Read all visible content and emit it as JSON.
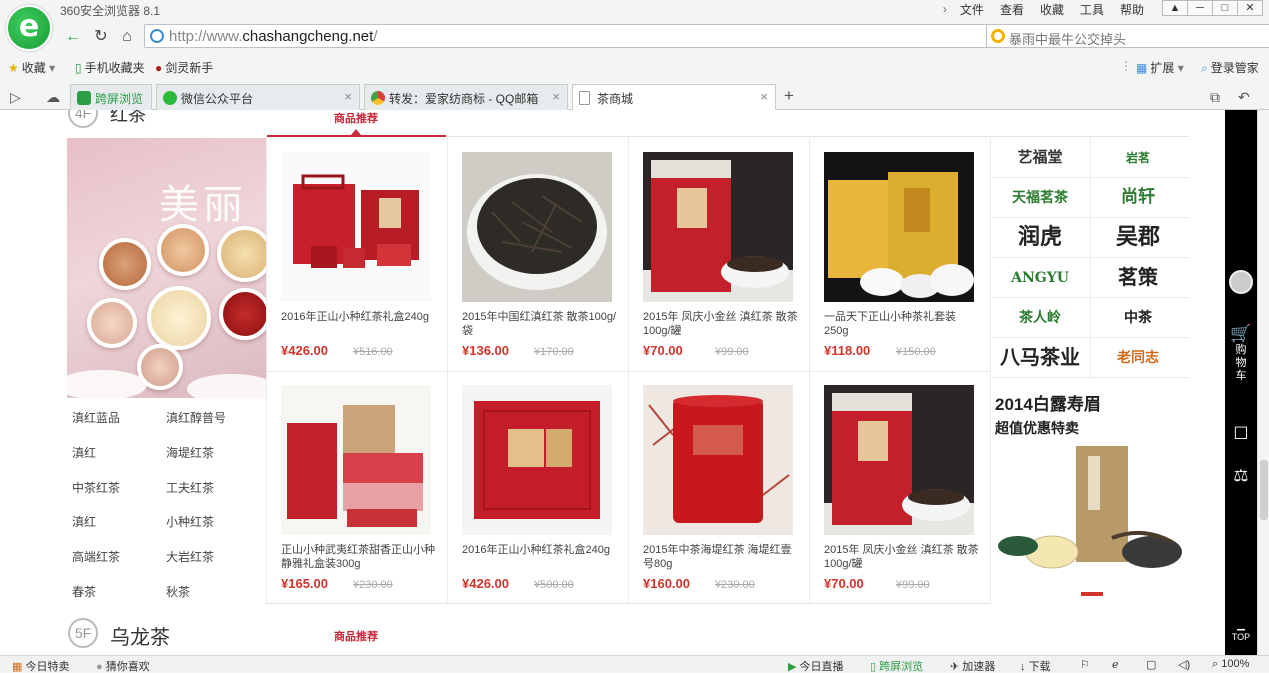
{
  "browser": {
    "app_title": "360安全浏览器 8.1",
    "menus": [
      "文件",
      "查看",
      "收藏",
      "工具",
      "帮助"
    ],
    "url_prefix": "http://www.",
    "url_domain": "chashangcheng.net",
    "url_suffix": "/",
    "search_placeholder": "暴雨中最牛公交掉头",
    "favorites": [
      {
        "label": "收藏",
        "icon": "star-icon"
      },
      {
        "label": "手机收藏夹",
        "icon": "phone-icon"
      },
      {
        "label": "剑灵新手",
        "icon": "sword-icon"
      }
    ],
    "extensions_label": "扩展",
    "login_label": "登录管家",
    "tabs": [
      {
        "label": "跨屏浏览",
        "icon": "phone-icon"
      },
      {
        "label": "微信公众平台",
        "icon": "wechat-icon"
      },
      {
        "label": "转发：爱家纺商标 - QQ邮箱",
        "icon": "chrome-icon"
      },
      {
        "label": "茶商城",
        "icon": "page-icon"
      }
    ]
  },
  "floors": [
    {
      "num": "4F",
      "title": "红茶",
      "tab": "商品推荐"
    },
    {
      "num": "5F",
      "title": "乌龙茶",
      "tab": "商品推荐"
    }
  ],
  "banner_text": "美丽",
  "categories": [
    "滇红蓝品",
    "滇红醇普号",
    "滇红",
    "海堤红茶",
    "中茶红茶",
    "工夫红茶",
    "滇红",
    "小种红茶",
    "高端红茶",
    "大岩红茶",
    "春茶",
    "秋茶"
  ],
  "products": [
    {
      "name": "2016年正山小种红茶礼盒240g",
      "price": "¥426.00",
      "old": "¥516.00"
    },
    {
      "name": "2015年中国红滇红茶 散茶100g/袋",
      "price": "¥136.00",
      "old": "¥170.00"
    },
    {
      "name": "2015年 凤庆小金丝 滇红茶 散茶 100g/罐",
      "price": "¥70.00",
      "old": "¥99.00"
    },
    {
      "name": "一品天下正山小种茶礼套装250g",
      "price": "¥118.00",
      "old": "¥150.00"
    },
    {
      "name": "正山小种武夷红茶甜香正山小种静雅礼盒装300g",
      "price": "¥165.00",
      "old": "¥230.00"
    },
    {
      "name": "2016年正山小种红茶礼盒240g",
      "price": "¥426.00",
      "old": "¥500.00"
    },
    {
      "name": "2015年中茶海堤红茶 海堤红壹号80g",
      "price": "¥160.00",
      "old": "¥230.00"
    },
    {
      "name": "2015年 凤庆小金丝 滇红茶 散茶 100g/罐",
      "price": "¥70.00",
      "old": "¥99.00"
    }
  ],
  "brands": [
    {
      "name": "艺福堂",
      "color": "#333"
    },
    {
      "name": "岩茗",
      "color": "#2e7d32"
    },
    {
      "name": "天福茗茶",
      "color": "#2e7d32"
    },
    {
      "name": "尚轩",
      "color": "#2e7d32"
    },
    {
      "name": "润虎",
      "color": "#222"
    },
    {
      "name": "吴郡",
      "color": "#222"
    },
    {
      "name": "ANGYU",
      "color": "#2e7d32"
    },
    {
      "name": "茗策",
      "color": "#222"
    },
    {
      "name": "茶人岭",
      "color": "#2e7d32"
    },
    {
      "name": "中茶",
      "color": "#222"
    },
    {
      "name": "八马茶业",
      "color": "#222"
    },
    {
      "name": "老同志",
      "color": "#d06a1a"
    }
  ],
  "promo": {
    "title": "2014白露寿眉",
    "subtitle": "超值优惠特卖"
  },
  "sidebar": {
    "cart": "购物车",
    "top": "TOP"
  },
  "status": {
    "today_deals": "今日特卖",
    "guess": "猜你喜欢",
    "live": "今日直播",
    "cross": "跨屏浏览",
    "accel": "加速器",
    "download": "下载",
    "zoom": "100%"
  }
}
